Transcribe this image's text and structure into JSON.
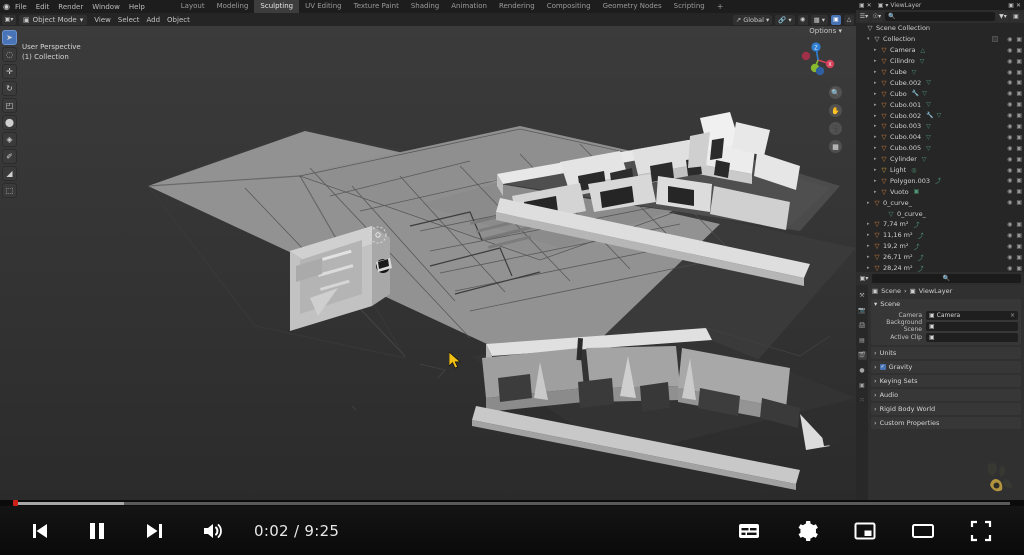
{
  "app": {
    "name": "Blender",
    "logo_icon": "blender-logo-icon"
  },
  "topbar": {
    "menus": [
      "File",
      "Edit",
      "Render",
      "Window",
      "Help"
    ],
    "workspace_tabs": [
      {
        "label": "Layout",
        "active": false
      },
      {
        "label": "Modeling",
        "active": false
      },
      {
        "label": "Sculpting",
        "active": true
      },
      {
        "label": "UV Editing",
        "active": false
      },
      {
        "label": "Texture Paint",
        "active": false
      },
      {
        "label": "Shading",
        "active": false
      },
      {
        "label": "Animation",
        "active": false
      },
      {
        "label": "Rendering",
        "active": false
      },
      {
        "label": "Compositing",
        "active": false
      },
      {
        "label": "Geometry Nodes",
        "active": false
      },
      {
        "label": "Scripting",
        "active": false
      }
    ],
    "add_tab_label": "+",
    "scene_name": "Scene",
    "viewlayer_name": "ViewLayer"
  },
  "viewport_header": {
    "editor_type_icon": "editor-type-icon",
    "mode": "Object Mode",
    "menus": [
      "View",
      "Select",
      "Add",
      "Object"
    ],
    "transform_orientation": "Global",
    "snap_icon": "magnet-icon",
    "proportional_icon": "proportional-edit-icon",
    "options_label": "Options"
  },
  "viewport": {
    "perspective_label": "User Perspective",
    "collection_label": "(1) Collection",
    "tools": [
      {
        "name": "tweak-tool",
        "glyph": "➤",
        "active": true
      },
      {
        "name": "select-box-tool",
        "glyph": "◌",
        "active": false
      },
      {
        "name": "move-tool",
        "glyph": "✛",
        "active": false
      },
      {
        "name": "rotate-tool",
        "glyph": "↻",
        "active": false
      },
      {
        "name": "scale-tool",
        "glyph": "◰",
        "active": false
      },
      {
        "name": "transform-tool",
        "glyph": "⬤",
        "active": false
      },
      {
        "name": "cad-tool",
        "glyph": "◈",
        "active": false
      },
      {
        "name": "annotate-tool",
        "glyph": "✐",
        "active": false
      },
      {
        "name": "measure-tool",
        "glyph": "◢",
        "active": false
      },
      {
        "name": "add-cube-tool",
        "glyph": "⬚",
        "active": false
      }
    ],
    "gizmo_axes": [
      {
        "name": "x-axis",
        "color": "#d3405a",
        "label": "X"
      },
      {
        "name": "y-axis",
        "color": "#8ab92f",
        "label": "Y"
      },
      {
        "name": "z-axis",
        "color": "#2f7fd3",
        "label": "Z"
      }
    ],
    "nav_buttons": [
      {
        "name": "zoom-nav-icon",
        "glyph": "🔍"
      },
      {
        "name": "pan-nav-icon",
        "glyph": "✋"
      },
      {
        "name": "camera-nav-icon",
        "glyph": "🎥"
      },
      {
        "name": "grid-nav-icon",
        "glyph": "▦"
      }
    ],
    "shading_modes": [
      "wireframe",
      "solid",
      "material-preview",
      "rendered"
    ],
    "active_shading_mode": "solid"
  },
  "outliner": {
    "display_mode": "View Layer",
    "search_placeholder": "",
    "filter_icon": "filter-icon",
    "root": "Scene Collection",
    "rows": [
      {
        "label": "Scene Collection",
        "indent": 0,
        "icon": "collection-icon",
        "icon_color": "#c8c8c8",
        "tri": "",
        "mods": [],
        "eye": false
      },
      {
        "label": "Collection",
        "indent": 1,
        "icon": "collection-icon",
        "icon_color": "#c8c8c8",
        "tri": "▾",
        "mods": [],
        "eye": true,
        "checkbox": true
      },
      {
        "label": "Camera",
        "indent": 2,
        "icon": "camera-data-icon",
        "icon_color": "#d8843c",
        "tri": "▸",
        "mods": [
          "△"
        ],
        "eye": true
      },
      {
        "label": "Cilindro",
        "indent": 2,
        "icon": "mesh-icon",
        "icon_color": "#d8843c",
        "tri": "▸",
        "mods": [
          "▽"
        ],
        "eye": true
      },
      {
        "label": "Cube",
        "indent": 2,
        "icon": "mesh-icon",
        "icon_color": "#d8843c",
        "tri": "▸",
        "mods": [
          "▽"
        ],
        "eye": true
      },
      {
        "label": "Cube.002",
        "indent": 2,
        "icon": "mesh-icon",
        "icon_color": "#d8843c",
        "tri": "▸",
        "mods": [
          "▽"
        ],
        "eye": true
      },
      {
        "label": "Cubo",
        "indent": 2,
        "icon": "mesh-icon",
        "icon_color": "#d8843c",
        "tri": "▸",
        "mods": [
          "🔧",
          "▽"
        ],
        "eye": true
      },
      {
        "label": "Cubo.001",
        "indent": 2,
        "icon": "mesh-icon",
        "icon_color": "#d8843c",
        "tri": "▸",
        "mods": [
          "▽"
        ],
        "eye": true
      },
      {
        "label": "Cubo.002",
        "indent": 2,
        "icon": "mesh-icon",
        "icon_color": "#d8843c",
        "tri": "▸",
        "mods": [
          "🔧",
          "▽"
        ],
        "eye": true
      },
      {
        "label": "Cubo.003",
        "indent": 2,
        "icon": "mesh-icon",
        "icon_color": "#d8843c",
        "tri": "▸",
        "mods": [
          "▽"
        ],
        "eye": true
      },
      {
        "label": "Cubo.004",
        "indent": 2,
        "icon": "mesh-icon",
        "icon_color": "#d8843c",
        "tri": "▸",
        "mods": [
          "▽"
        ],
        "eye": true
      },
      {
        "label": "Cubo.005",
        "indent": 2,
        "icon": "mesh-icon",
        "icon_color": "#d8843c",
        "tri": "▸",
        "mods": [
          "▽"
        ],
        "eye": true
      },
      {
        "label": "Cylinder",
        "indent": 2,
        "icon": "mesh-icon",
        "icon_color": "#d8843c",
        "tri": "▸",
        "mods": [
          "▽"
        ],
        "eye": true
      },
      {
        "label": "Light",
        "indent": 2,
        "icon": "light-icon",
        "icon_color": "#d8b03c",
        "tri": "▸",
        "mods": [
          "◎"
        ],
        "eye": true
      },
      {
        "label": "Polygon.003",
        "indent": 2,
        "icon": "curve-icon",
        "icon_color": "#d8843c",
        "tri": "▸",
        "mods": [
          "⤴"
        ],
        "eye": true
      },
      {
        "label": "Vuoto",
        "indent": 2,
        "icon": "empty-image-icon",
        "icon_color": "#d8843c",
        "tri": "▸",
        "mods": [
          "▣"
        ],
        "eye": true
      },
      {
        "label": "0_curve_",
        "indent": 1,
        "icon": "curve-icon",
        "icon_color": "#d8843c",
        "tri": "▸",
        "mods": [],
        "eye": true
      },
      {
        "label": "0_curve_",
        "indent": 3,
        "icon": "curve-data-icon",
        "icon_color": "#4f9a78",
        "tri": "",
        "mods": [],
        "eye": false
      },
      {
        "label": "7,74 m²",
        "indent": 1,
        "icon": "text-icon",
        "icon_color": "#d8843c",
        "tri": "▸",
        "mods": [
          "⤴"
        ],
        "eye": true
      },
      {
        "label": "11,16 m²",
        "indent": 1,
        "icon": "text-icon",
        "icon_color": "#d8843c",
        "tri": "▸",
        "mods": [
          "⤴"
        ],
        "eye": true
      },
      {
        "label": "19,2 m²",
        "indent": 1,
        "icon": "text-icon",
        "icon_color": "#d8843c",
        "tri": "▸",
        "mods": [
          "⤴"
        ],
        "eye": true
      },
      {
        "label": "26,71 m²",
        "indent": 1,
        "icon": "text-icon",
        "icon_color": "#d8843c",
        "tri": "▸",
        "mods": [
          "⤴"
        ],
        "eye": true
      },
      {
        "label": "28,24 m²",
        "indent": 1,
        "icon": "text-icon",
        "icon_color": "#d8843c",
        "tri": "▸",
        "mods": [
          "⤴"
        ],
        "eye": true
      }
    ]
  },
  "properties": {
    "tabs": [
      {
        "name": "tool-tab",
        "glyph": "⚒",
        "active": false
      },
      {
        "name": "render-tab",
        "glyph": "📷",
        "active": false
      },
      {
        "name": "output-tab",
        "glyph": "🖨",
        "active": false
      },
      {
        "name": "viewlayer-tab",
        "glyph": "▤",
        "active": false
      },
      {
        "name": "scene-tab",
        "glyph": "🎬",
        "active": true
      },
      {
        "name": "world-tab",
        "glyph": "●",
        "active": false
      },
      {
        "name": "object-tab",
        "glyph": "▣",
        "active": false
      },
      {
        "name": "particles-tab",
        "glyph": "⁙",
        "active": false
      }
    ],
    "breadcrumb": [
      "Scene",
      "ViewLayer"
    ],
    "scene_panel": {
      "title": "Scene",
      "fields": [
        {
          "label": "Camera",
          "value": "Camera",
          "icon": "camera-icon",
          "clear": "×"
        },
        {
          "label": "Background Scene",
          "value": "",
          "icon": "scene-icon",
          "clear": ""
        },
        {
          "label": "Active Clip",
          "value": "",
          "icon": "clip-icon",
          "clear": ""
        }
      ]
    },
    "sections": [
      {
        "label": "Units",
        "checkbox": false
      },
      {
        "label": "Gravity",
        "checkbox": true
      },
      {
        "label": "Keying Sets",
        "checkbox": false
      },
      {
        "label": "Audio",
        "checkbox": false
      },
      {
        "label": "Rigid Body World",
        "checkbox": false
      },
      {
        "label": "Custom Properties",
        "checkbox": false
      }
    ],
    "watermark_icon": "leaf-logo-icon"
  },
  "player": {
    "current_time": "0:02",
    "duration": "9:25",
    "time_display": "0:02 / 9:25",
    "progress_percent": 0.4,
    "loaded_percent": 11,
    "accent_color": "#cf2017",
    "left_controls": [
      {
        "name": "previous-button",
        "icon": "previous-track-icon"
      },
      {
        "name": "pause-button",
        "icon": "pause-icon"
      },
      {
        "name": "next-button",
        "icon": "next-track-icon"
      },
      {
        "name": "volume-button",
        "icon": "volume-icon"
      }
    ],
    "right_controls": [
      {
        "name": "subtitles-button",
        "icon": "subtitles-icon"
      },
      {
        "name": "settings-button",
        "icon": "gear-icon"
      },
      {
        "name": "miniplayer-button",
        "icon": "picture-in-picture-icon"
      },
      {
        "name": "theater-button",
        "icon": "theater-mode-icon"
      },
      {
        "name": "fullscreen-button",
        "icon": "fullscreen-icon"
      }
    ]
  }
}
